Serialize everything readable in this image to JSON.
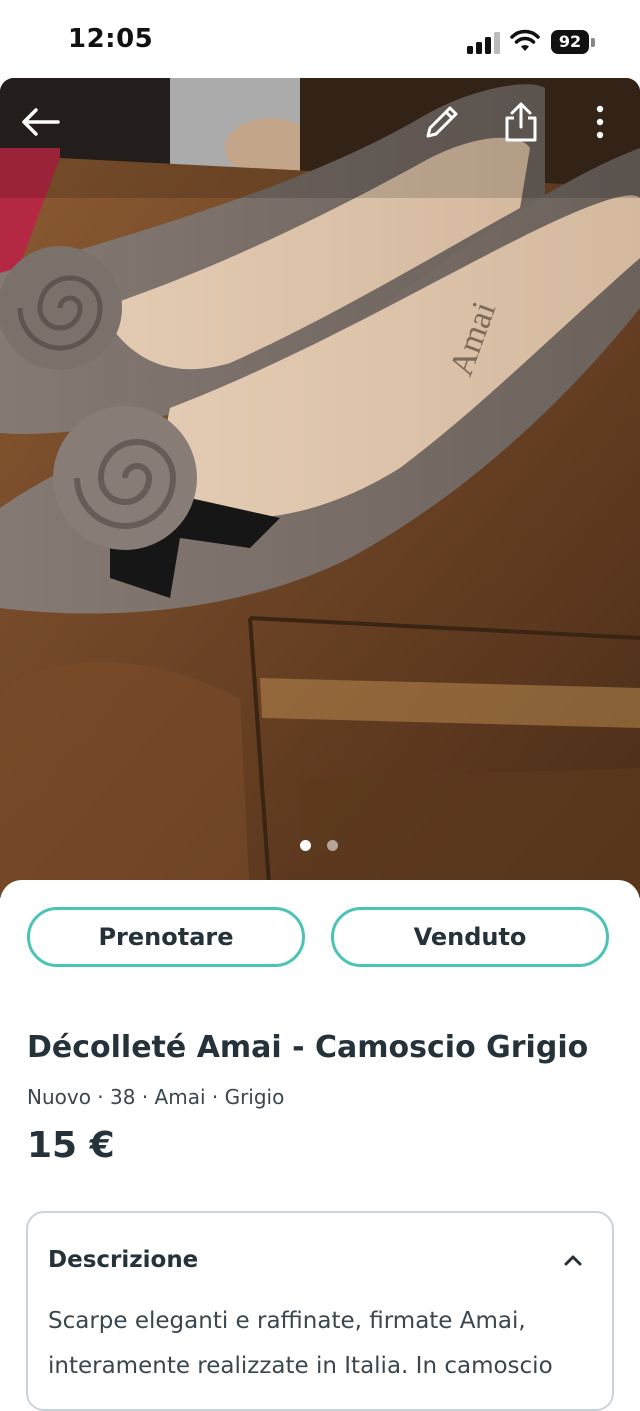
{
  "status_bar": {
    "time": "12:05",
    "battery": "92"
  },
  "photo": {
    "current_index": 1,
    "total": 2,
    "icons": [
      "arrow-left-icon",
      "pencil-icon",
      "share-icon",
      "more-vertical-icon"
    ]
  },
  "actions": {
    "reserve_label": "Prenotare",
    "sold_label": "Venduto"
  },
  "listing": {
    "title": "Décolleté Amai - Camoscio Grigio",
    "meta": "Nuovo · 38 · Amai · Grigio",
    "price": "15 €"
  },
  "description": {
    "title": "Descrizione",
    "text": "Scarpe eleganti e raffinate, firmate Amai, interamente realizzate in Italia. In camoscio"
  },
  "colors": {
    "accent": "#4cc4b3",
    "text": "#25323a",
    "border": "#c9d4da"
  }
}
